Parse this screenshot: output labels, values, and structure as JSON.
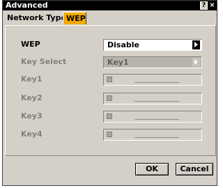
{
  "window": {
    "title": "Advanced",
    "help_label": "?",
    "close_label": "×"
  },
  "tabs": [
    {
      "label": "Network Type",
      "active": false
    },
    {
      "label": "WEP",
      "active": true
    }
  ],
  "wep": {
    "label": "WEP",
    "value": "Disable"
  },
  "key_select": {
    "label": "Key Select",
    "value": "Key1"
  },
  "keys": [
    {
      "label": "Key1"
    },
    {
      "label": "Key2"
    },
    {
      "label": "Key3"
    },
    {
      "label": "Key4"
    }
  ],
  "buttons": {
    "ok": "OK",
    "cancel": "Cancel"
  },
  "colors": {
    "active_tab": "#f2a900",
    "titlebar": "#000000",
    "dialog_bg": "#d4d0c8"
  }
}
